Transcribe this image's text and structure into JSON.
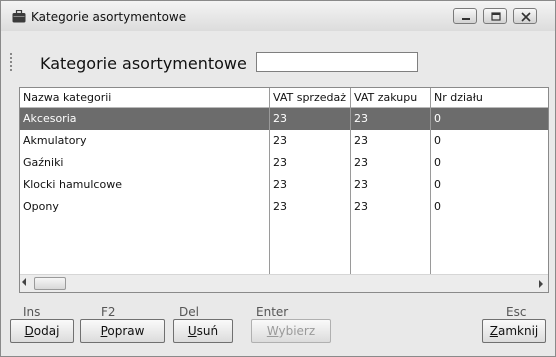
{
  "window": {
    "title": "Kategorie asortymentowe",
    "icon": "briefcase-icon"
  },
  "toolbar": {
    "label": "Kategorie asortymentowe",
    "search_value": ""
  },
  "grid": {
    "columns": [
      "Nazwa kategorii",
      "VAT sprzedaż",
      "VAT zakupu",
      "Nr działu"
    ],
    "rows": [
      {
        "name": "Akcesoria",
        "vat_sale": "23",
        "vat_purchase": "23",
        "dept": "0",
        "selected": true
      },
      {
        "name": "Akmulatory",
        "vat_sale": "23",
        "vat_purchase": "23",
        "dept": "0",
        "selected": false
      },
      {
        "name": "Gaźniki",
        "vat_sale": "23",
        "vat_purchase": "23",
        "dept": "0",
        "selected": false
      },
      {
        "name": "Klocki hamulcowe",
        "vat_sale": "23",
        "vat_purchase": "23",
        "dept": "0",
        "selected": false
      },
      {
        "name": "Opony",
        "vat_sale": "23",
        "vat_purchase": "23",
        "dept": "0",
        "selected": false
      }
    ]
  },
  "footer": {
    "buttons": [
      {
        "key": "Ins",
        "first": "D",
        "rest": "odaj",
        "enabled": true
      },
      {
        "key": "F2",
        "first": "P",
        "rest": "opraw",
        "enabled": true
      },
      {
        "key": "Del",
        "first": "U",
        "rest": "suń",
        "enabled": true
      },
      {
        "key": "Enter",
        "first": "W",
        "rest": "ybierz",
        "enabled": false
      },
      {
        "key": "Esc",
        "first": "Z",
        "rest": "amknij",
        "enabled": true
      }
    ]
  }
}
